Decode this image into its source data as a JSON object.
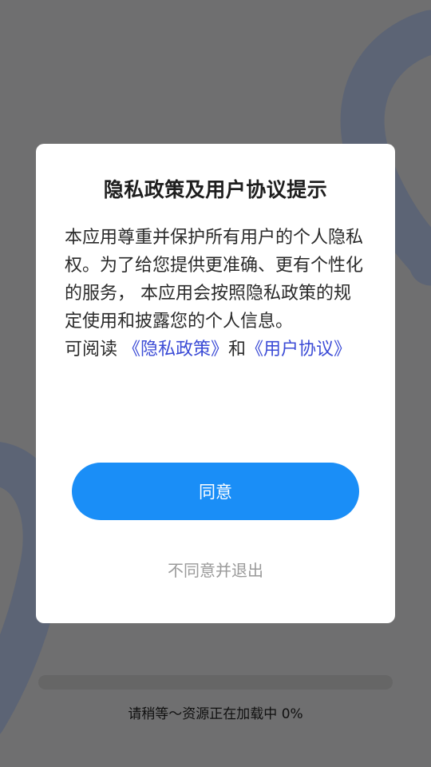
{
  "dialog": {
    "title": "隐私政策及用户协议提示",
    "body_text": "本应用尊重并保护所有用户的个人隐私权。为了给您提供更准确、更有个性化的服务， 本应用会按照隐私政策的规定使用和披露您的个人信息。",
    "read_prefix": "可阅读 ",
    "privacy_link": "《隐私政策》",
    "conjunction": "和",
    "agreement_link": "《用户协议》",
    "agree_label": "同意",
    "disagree_label": "不同意并退出"
  },
  "loading": {
    "text": "请稍等～资源正在加载中 0%",
    "progress_fraction": 0
  },
  "colors": {
    "overlay": "#6f6f70",
    "accent": "#1a8ef7",
    "link": "#3b4bd6",
    "decor_stroke": "#5c6475"
  }
}
